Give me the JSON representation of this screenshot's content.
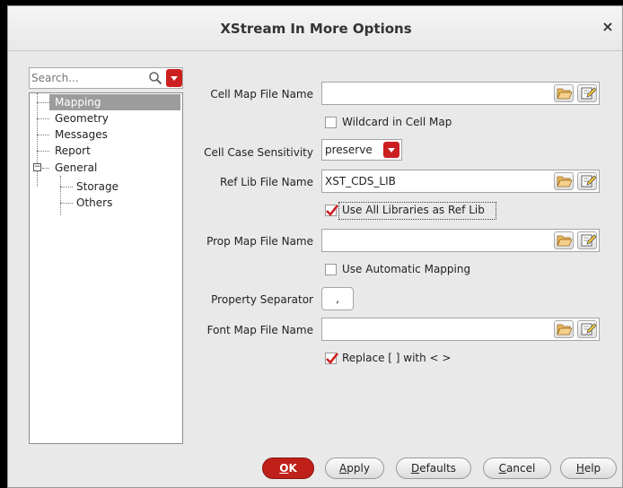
{
  "window": {
    "title": "XStream In More Options",
    "close_label": "×"
  },
  "search": {
    "placeholder": "Search..."
  },
  "tree": {
    "items": [
      {
        "label": "Mapping",
        "selected": true
      },
      {
        "label": "Geometry"
      },
      {
        "label": "Messages"
      },
      {
        "label": "Report"
      },
      {
        "label": "General",
        "expander": "−"
      },
      {
        "label": "Storage"
      },
      {
        "label": "Others"
      }
    ]
  },
  "form": {
    "cell_map": {
      "label": "Cell Map File Name",
      "value": ""
    },
    "wildcard": {
      "label": "Wildcard in Cell Map",
      "checked": false
    },
    "case_sensitivity": {
      "label": "Cell Case Sensitivity",
      "value": "preserve"
    },
    "ref_lib": {
      "label": "Ref Lib File Name",
      "value": "XST_CDS_LIB"
    },
    "use_all_libs": {
      "label": "Use All Libraries as Ref Lib",
      "checked": true
    },
    "prop_map": {
      "label": "Prop Map File Name",
      "value": ""
    },
    "auto_mapping": {
      "label": "Use Automatic Mapping",
      "checked": false
    },
    "prop_separator": {
      "label": "Property Separator",
      "value": ","
    },
    "font_map": {
      "label": "Font Map File Name",
      "value": ""
    },
    "replace_brackets": {
      "label": "Replace [ ] with < >",
      "checked": true
    }
  },
  "buttons": {
    "ok": {
      "mnemonic": "O",
      "rest": "K"
    },
    "apply": {
      "mnemonic": "A",
      "rest": "pply"
    },
    "defaults": {
      "mnemonic": "D",
      "rest": "efaults"
    },
    "cancel": {
      "mnemonic": "C",
      "rest": "ancel"
    },
    "help": {
      "mnemonic": "H",
      "rest": "elp"
    }
  },
  "colors": {
    "accent": "#cc1f1f",
    "checkmark": "#cc1f1f",
    "selection": "#9c9c9c"
  },
  "icons": {
    "browse": "folder-open-icon",
    "edit": "edit-icon",
    "search": "search-icon",
    "dropdown": "chevron-down-icon"
  }
}
